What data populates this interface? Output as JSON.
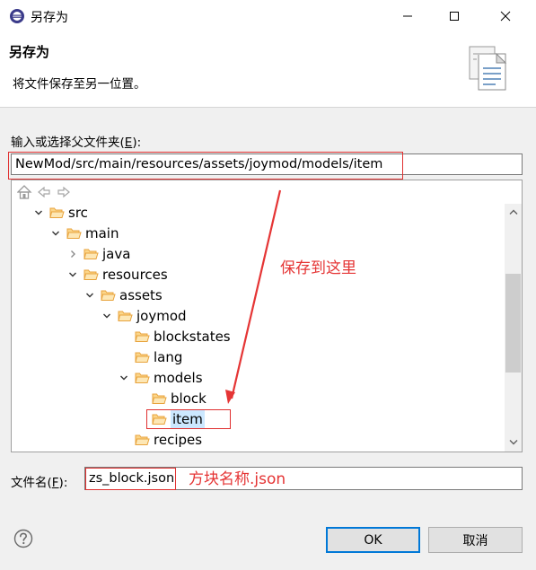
{
  "window": {
    "title": "另存为",
    "icons": {
      "app": "eclipse-logo-icon",
      "minimize": "minimize-icon",
      "maximize": "maximize-icon",
      "close": "close-icon"
    }
  },
  "banner": {
    "title": "另存为",
    "description": "将文件保存至另一位置。",
    "art_icon": "save-documents-icon"
  },
  "parent_folder": {
    "label_prefix": "输入或选择父文件夹(",
    "label_mnemonic": "E",
    "label_suffix": "):",
    "value": "NewMod/src/main/resources/assets/joymod/models/item"
  },
  "tree": {
    "toolbar_icons": [
      "home-icon",
      "back-icon",
      "forward-icon"
    ],
    "rows": [
      {
        "label": "src",
        "depth": 0,
        "expanded": true
      },
      {
        "label": "main",
        "depth": 1,
        "expanded": true
      },
      {
        "label": "java",
        "depth": 2,
        "expanded": false
      },
      {
        "label": "resources",
        "depth": 2,
        "expanded": true
      },
      {
        "label": "assets",
        "depth": 3,
        "expanded": true
      },
      {
        "label": "joymod",
        "depth": 4,
        "expanded": true
      },
      {
        "label": "blockstates",
        "depth": 5,
        "expanded": null
      },
      {
        "label": "lang",
        "depth": 5,
        "expanded": null
      },
      {
        "label": "models",
        "depth": 5,
        "expanded": true
      },
      {
        "label": "block",
        "depth": 6,
        "expanded": null
      },
      {
        "label": "item",
        "depth": 6,
        "expanded": null,
        "selected": true
      },
      {
        "label": "recipes",
        "depth": 5,
        "expanded": null
      }
    ],
    "scroll_position": 0.46
  },
  "annotations": {
    "save_here": "保存到这里",
    "file_name": "方块名称.json",
    "annotation_color": "#e53535"
  },
  "filename": {
    "label_prefix": "文件名(",
    "label_mnemonic": "F",
    "label_suffix": "):",
    "value": "zs_block.json"
  },
  "buttons": {
    "help_icon": "help-icon",
    "ok": "OK",
    "cancel": "取消"
  },
  "colors": {
    "selection": "#cce8ff",
    "folder": "#e8a33c",
    "primary_button_border": "#0078d7"
  }
}
